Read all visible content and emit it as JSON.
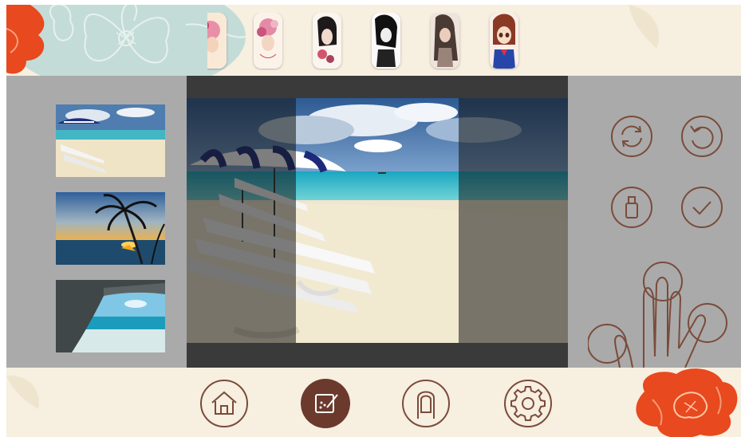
{
  "app": {
    "title": ""
  },
  "colors": {
    "cream_background": "#f7efe0",
    "panel_gray": "#aaaaaa",
    "canvas_dark": "#3a3a3a",
    "icon_brown": "#7a4b3a",
    "active_brown": "#6b3a2c",
    "flower_red": "#e8491e",
    "flower_teal": "#c4dcd7"
  },
  "template_strip": {
    "items": [
      {
        "name": "pink-floral-girl"
      },
      {
        "name": "girl-with-flowers"
      },
      {
        "name": "dark-hair-girl"
      },
      {
        "name": "black-white-girl"
      },
      {
        "name": "long-hair-girl"
      },
      {
        "name": "anime-girl"
      }
    ]
  },
  "photo_list": {
    "items": [
      {
        "name": "beach-umbrellas-photo",
        "selected": true
      },
      {
        "name": "palm-sunset-photo",
        "selected": false
      },
      {
        "name": "sea-cave-photo",
        "selected": false
      }
    ]
  },
  "editor": {
    "image": "beach-umbrellas-photo",
    "crop_window": {
      "shape": "portrait-rectangle"
    }
  },
  "tools": [
    {
      "name": "sync-icon"
    },
    {
      "name": "undo-icon"
    },
    {
      "name": "usb-icon"
    },
    {
      "name": "check-icon"
    }
  ],
  "hint": {
    "icon": "multi-touch-gesture-icon"
  },
  "bottom_nav": {
    "items": [
      {
        "name": "home-icon",
        "active": false
      },
      {
        "name": "editor-icon",
        "active": true
      },
      {
        "name": "touch-icon",
        "active": false
      },
      {
        "name": "settings-icon",
        "active": false
      }
    ]
  }
}
